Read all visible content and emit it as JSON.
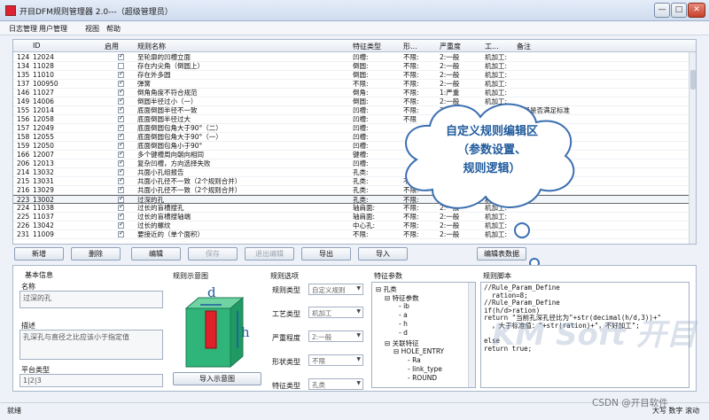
{
  "window": {
    "title": "开目DFM规则管理器 2.0---（超级管理员）",
    "buttons": [
      "—",
      "□",
      "✕"
    ]
  },
  "menu": {
    "items": [
      "日志管理",
      "用户管理",
      "视图",
      "帮助"
    ]
  },
  "grid": {
    "columns": [
      "ID",
      "启用",
      "规则名称",
      "特征类型",
      "形...",
      "严重度",
      "工...",
      "备注"
    ],
    "rows": [
      {
        "no": "124",
        "id": "12024",
        "on": true,
        "name": "至轮廓的凹槽立面",
        "feat": "凹槽:",
        "shape": "不限:",
        "sev": "2:一般",
        "proc": "机加工:",
        "note": ""
      },
      {
        "no": "134",
        "id": "11028",
        "on": false,
        "name": "存在内尖角（倒圆上）",
        "feat": "倒圆:",
        "shape": "不限:",
        "sev": "2:一般",
        "proc": "机加工:",
        "note": ""
      },
      {
        "no": "135",
        "id": "11010",
        "on": true,
        "name": "存在外多圆",
        "feat": "倒圆:",
        "shape": "不限:",
        "sev": "2:一般",
        "proc": "机加工:",
        "note": ""
      },
      {
        "no": "137",
        "id": "100950",
        "on": true,
        "name": "弹簧",
        "feat": "不限:",
        "shape": "不限:",
        "sev": "2:一般",
        "proc": "机加工:",
        "note": ""
      },
      {
        "no": "146",
        "id": "11027",
        "on": true,
        "name": "倒角角度不符合规范",
        "feat": "倒角:",
        "shape": "不限:",
        "sev": "1:严重",
        "proc": "机加工:",
        "note": ""
      },
      {
        "no": "149",
        "id": "14006",
        "on": true,
        "name": "倒圆半径过小（一）",
        "feat": "倒圆:",
        "shape": "不限:",
        "sev": "2:一般",
        "proc": "机加工:",
        "note": ""
      },
      {
        "no": "155",
        "id": "12014",
        "on": true,
        "name": "底面倒圆半径不一致",
        "feat": "凹槽:",
        "shape": "不限:",
        "sev": "2:一般",
        "proc": "",
        "note": "半径是否满足标准"
      },
      {
        "no": "156",
        "id": "12058",
        "on": true,
        "name": "底面倒圆半径过大",
        "feat": "凹槽:",
        "shape": "不限",
        "sev": "",
        "proc": "",
        "note": ""
      },
      {
        "no": "157",
        "id": "12049",
        "on": true,
        "name": "底面倒圆包角大于90°（二）",
        "feat": "凹槽:",
        "shape": "",
        "sev": "",
        "proc": "",
        "note": ""
      },
      {
        "no": "158",
        "id": "12055",
        "on": true,
        "name": "底面倒圆包角大于90°（一）",
        "feat": "凹槽:",
        "shape": "",
        "sev": "",
        "proc": "",
        "note": ""
      },
      {
        "no": "159",
        "id": "12050",
        "on": true,
        "name": "底面倒圆包角小于90°",
        "feat": "凹槽:",
        "shape": "",
        "sev": "",
        "proc": "",
        "note": ""
      },
      {
        "no": "166",
        "id": "12007",
        "on": true,
        "name": "多个键槽周向朝向相同",
        "feat": "键槽:",
        "shape": "",
        "sev": "",
        "proc": "",
        "note": ""
      },
      {
        "no": "206",
        "id": "12013",
        "on": true,
        "name": "复杂凹槽，方向选择失败",
        "feat": "凹槽:",
        "shape": "",
        "sev": "",
        "proc": "",
        "note": ""
      },
      {
        "no": "214",
        "id": "13032",
        "on": true,
        "name": "共面小孔组报告",
        "feat": "孔类:",
        "shape": "",
        "sev": "",
        "proc": "",
        "note": ""
      },
      {
        "no": "215",
        "id": "13031",
        "on": true,
        "name": "共面小孔径不一致（2个规则合并）",
        "feat": "孔类:",
        "shape": "不限:",
        "sev": "",
        "proc": "",
        "note": ""
      },
      {
        "no": "216",
        "id": "13029",
        "on": true,
        "name": "共面小孔径不一致（2个规则合并）",
        "feat": "孔类:",
        "shape": "不限:",
        "sev": "2:一般",
        "proc": "",
        "note": ""
      },
      {
        "no": "223",
        "id": "13002",
        "on": true,
        "name": "过深的孔",
        "feat": "孔类:",
        "shape": "不限:",
        "sev": "2:一般",
        "proc": "机加工:",
        "note": "CT"
      },
      {
        "no": "224",
        "id": "11038",
        "on": true,
        "name": "过长的盲槽搜孔",
        "feat": "轴肩面:",
        "shape": "不限:",
        "sev": "2:一般",
        "proc": "机加工:",
        "note": ""
      },
      {
        "no": "225",
        "id": "11037",
        "on": true,
        "name": "过长的盲槽搜轴端",
        "feat": "轴肩面:",
        "shape": "不限:",
        "sev": "2:一般",
        "proc": "机加工:",
        "note": ""
      },
      {
        "no": "226",
        "id": "13042",
        "on": true,
        "name": "过长的螺纹",
        "feat": "中心孔:",
        "shape": "不限:",
        "sev": "2:一般",
        "proc": "机加工:",
        "note": ""
      },
      {
        "no": "231",
        "id": "11009",
        "on": true,
        "name": "要接近的（单个面积）",
        "feat": "不限:",
        "shape": "不限:",
        "sev": "2:一般",
        "proc": "机加工:",
        "note": ""
      }
    ],
    "selected_index": 16
  },
  "toolbar": {
    "new": "新增",
    "delete": "删除",
    "edit": "编辑",
    "save": "保存",
    "exit_edit": "退出编辑",
    "export": "导出",
    "import": "导入",
    "edit_table": "编辑表数据"
  },
  "detail": {
    "basic_info": "基本信息",
    "name_label": "名称",
    "name_value": "过深的孔",
    "desc_label": "描述",
    "desc_value": "孔深孔与直径之比应该小于指定值",
    "platform_label": "平台类型",
    "platform_value": "1|2|3",
    "diagram_label": "规则示意图",
    "import_diagram": "导入示意图",
    "options_label": "规则选项",
    "rule_type_label": "规则类型",
    "rule_type_value": "自定义规则",
    "process_label": "工艺类型",
    "process_value": "机加工",
    "severity_label": "严重程度",
    "severity_value": "2:一般",
    "shape_label": "形状类型",
    "shape_value": "不限",
    "feature_label": "特征类型",
    "feature_value": "孔类",
    "feature_params_label": "特征参数",
    "tree": [
      "孔类",
      "特征参数",
      "ib",
      "a",
      "h",
      "d",
      "关联特征",
      "HOLE_ENTRY",
      "Ra",
      "link_type",
      "ROUND"
    ],
    "script_label": "规则脚本",
    "script": "//Rule_Param_Define\n  ration=8;\n//Rule_Param_Define\nif(h/d>ration)\nreturn \"当前孔深孔径比为\"+str(decimal(h/d,3))+\"\n  ，大于标准值：\"+str(ration)+\"，不好加工\";\n\nelse\nreturn true;"
  },
  "callout": {
    "line1": "自定义规则编辑区",
    "line2": "（参数设置、",
    "line3": "规则逻辑）"
  },
  "watermark": "KM Soft 开目",
  "status": {
    "left": "就绪",
    "right": "大写 数字 滚动"
  },
  "credit": "CSDN @开目软件",
  "colors": {
    "accent": "#1f5a9c",
    "callout_fill": "#ffffff",
    "callout_stroke": "#3b6fb0",
    "diagram_block": "#2fb47a",
    "hole": "#e0202a"
  }
}
